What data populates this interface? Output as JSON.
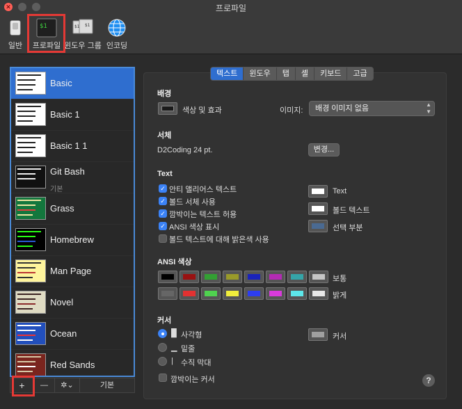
{
  "window": {
    "title": "프로파일",
    "close_glyph": "✕"
  },
  "toolbar": {
    "items": [
      {
        "label": "일반",
        "icon": "switch-icon"
      },
      {
        "label": "프로파일",
        "icon": "terminal-profile-icon"
      },
      {
        "label": "윈도우 그룹",
        "icon": "window-group-icon"
      },
      {
        "label": "인코딩",
        "icon": "globe-icon"
      }
    ]
  },
  "profiles": [
    {
      "name": "Basic",
      "sub": "",
      "thumb": "basic",
      "selected": true
    },
    {
      "name": "Basic 1",
      "sub": "",
      "thumb": "basic"
    },
    {
      "name": "Basic 1 1",
      "sub": "",
      "thumb": "basic"
    },
    {
      "name": "Git Bash",
      "sub": "기본",
      "thumb": "black"
    },
    {
      "name": "Grass",
      "sub": "",
      "thumb": "grass"
    },
    {
      "name": "Homebrew",
      "sub": "",
      "thumb": "homebrew"
    },
    {
      "name": "Man Page",
      "sub": "",
      "thumb": "manpage"
    },
    {
      "name": "Novel",
      "sub": "",
      "thumb": "novel"
    },
    {
      "name": "Ocean",
      "sub": "",
      "thumb": "ocean"
    },
    {
      "name": "Red Sands",
      "sub": "",
      "thumb": "redsands"
    }
  ],
  "list_buttons": {
    "add": "+",
    "remove": "—",
    "gear": "✲⌄",
    "default": "기본"
  },
  "tabs": [
    "텍스트",
    "윈도우",
    "탭",
    "셸",
    "키보드",
    "고급"
  ],
  "background": {
    "heading": "배경",
    "color_label": "색상 및 효과",
    "image_label": "이미지:",
    "image_value": "배경 이미지 없음"
  },
  "font": {
    "heading": "서체",
    "value": "D2Coding 24 pt.",
    "change_button": "변경..."
  },
  "text": {
    "heading": "Text",
    "options": [
      {
        "label": "안티 앨리어스 텍스트",
        "checked": true
      },
      {
        "label": "볼드 서체 사용",
        "checked": true
      },
      {
        "label": "깜박이는 텍스트 허용",
        "checked": true
      },
      {
        "label": "ANSI 색상 표시",
        "checked": true
      },
      {
        "label": "볼드 텍스트에 대해 밝은색 사용",
        "checked": false
      }
    ],
    "colors": [
      {
        "label": "Text",
        "color": "#ffffff"
      },
      {
        "label": "볼드 텍스트",
        "color": "#ffffff"
      },
      {
        "label": "선택 부분",
        "color": "#4a6a92"
      }
    ]
  },
  "ansi": {
    "heading": "ANSI 색상",
    "normal_label": "보통",
    "bright_label": "밝게",
    "normal": [
      "#000000",
      "#991111",
      "#33a033",
      "#999a2a",
      "#1a23bb",
      "#b32bb4",
      "#35a4a8",
      "#c6c6c6"
    ],
    "bright": [
      "#666666",
      "#e33131",
      "#4fd24f",
      "#f0ed3c",
      "#2d3df0",
      "#d83bdb",
      "#5de7ea",
      "#e8e8e8"
    ]
  },
  "cursor": {
    "heading": "커서",
    "options": [
      {
        "glyph": "█",
        "label": "사각형",
        "selected": true
      },
      {
        "glyph": "▁",
        "label": "밑줄",
        "selected": false
      },
      {
        "glyph": "|",
        "label": "수직 막대",
        "selected": false
      }
    ],
    "blink_label": "깜박이는 커서",
    "color_label": "커서",
    "color": "#a0a0a0"
  },
  "help_label": "?"
}
